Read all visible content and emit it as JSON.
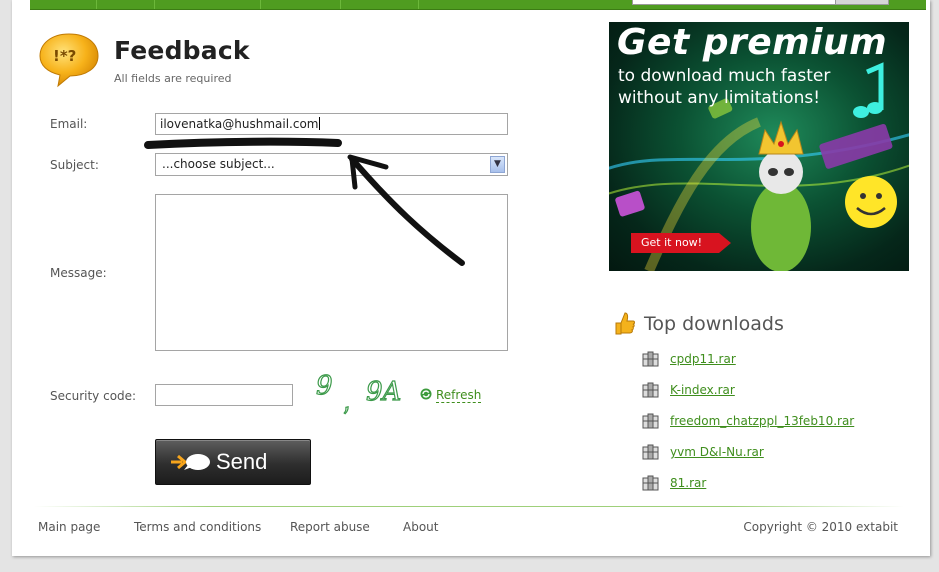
{
  "header": {
    "title": "Feedback",
    "subtitle": "All fields are required"
  },
  "form": {
    "email_label": "Email:",
    "email_value": "ilovenatka@hushmail.com",
    "subject_label": "Subject:",
    "subject_value": "...choose subject...",
    "message_label": "Message:",
    "message_value": "",
    "security_label": "Security code:",
    "security_value": "",
    "captcha_text": "9 , 9A",
    "refresh_label": "Refresh",
    "send_label": "Send"
  },
  "banner": {
    "title": "Get premium",
    "line1": "to download much faster",
    "line2": "without any limitations!",
    "cta": "Get it now!"
  },
  "top_downloads": {
    "title": "Top downloads",
    "items": [
      {
        "name": "cpdp11.rar"
      },
      {
        "name": "K-index.rar"
      },
      {
        "name": "freedom_chatzppl_13feb10.rar"
      },
      {
        "name": "yvm D&I-Nu.rar"
      },
      {
        "name": "81.rar"
      }
    ]
  },
  "footer": {
    "links": [
      "Main page",
      "Terms and conditions",
      "Report abuse",
      "About"
    ],
    "copyright": "Copyright © 2010 extabit"
  },
  "colors": {
    "accent_green": "#4f9c20",
    "link_green": "#3f8e1d",
    "cta_red": "#d8131f"
  }
}
